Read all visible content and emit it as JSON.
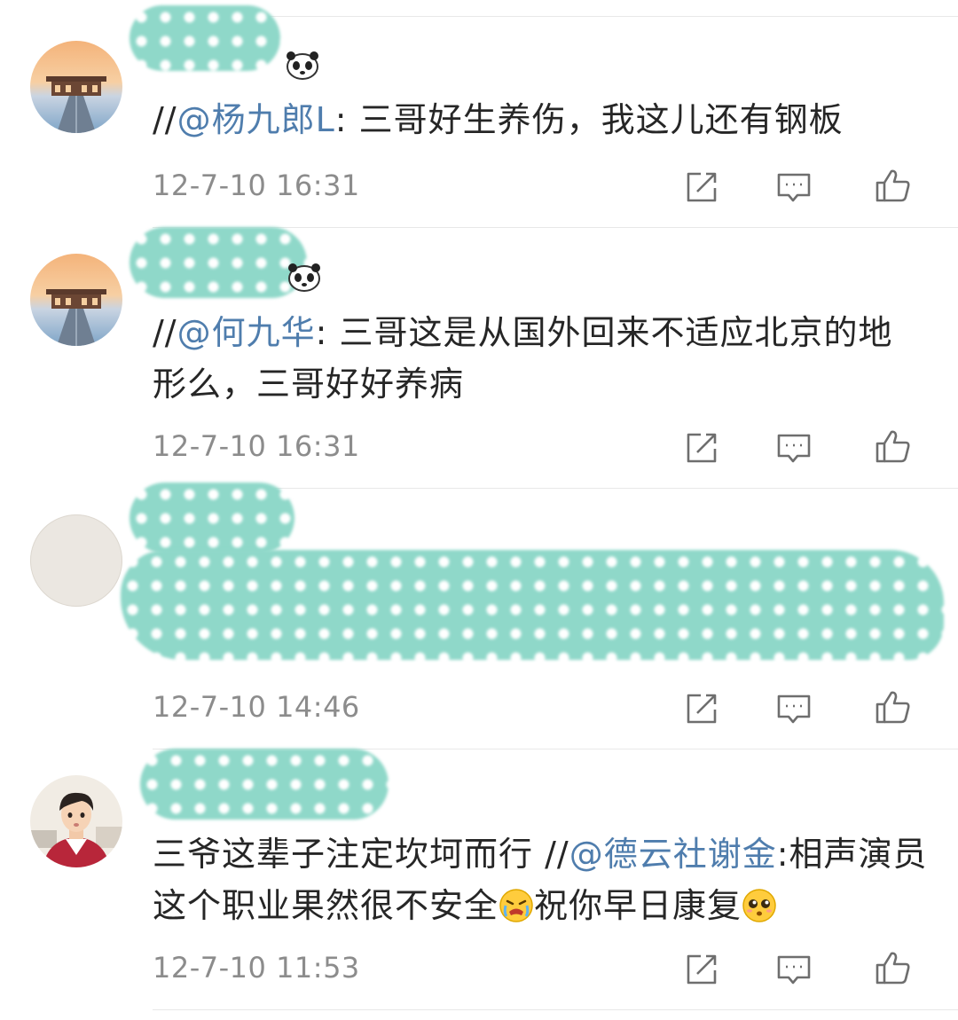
{
  "comments": [
    {
      "segments": [
        {
          "text": "//",
          "type": "plain"
        },
        {
          "text": "@杨九郎L",
          "type": "mention"
        },
        {
          "text": ": 三哥好生养伤，我这儿还有钢板",
          "type": "plain"
        }
      ],
      "time": "12-7-10 16:31"
    },
    {
      "segments": [
        {
          "text": "//",
          "type": "plain"
        },
        {
          "text": "@何九华",
          "type": "mention"
        },
        {
          "text": ": 三哥这是从国外回来不适应北京的地形么，三哥好好养病",
          "type": "plain"
        }
      ],
      "time": "12-7-10 16:31"
    },
    {
      "segments": [],
      "time": "12-7-10 14:46"
    },
    {
      "segments": [
        {
          "text": "三爷这辈子注定坎坷而行 //",
          "type": "plain"
        },
        {
          "text": "@德云社谢金",
          "type": "mention"
        },
        {
          "text": ":相声演员这个职业果然很不安全",
          "type": "plain"
        },
        {
          "text": "crying-emoji",
          "type": "emoji"
        },
        {
          "text": "祝你早日康复",
          "type": "plain"
        },
        {
          "text": "pleading-emoji",
          "type": "emoji"
        }
      ],
      "time": "12-7-10 11:53"
    }
  ],
  "icons": {
    "share": "share-icon",
    "comment": "comment-icon",
    "like": "thumbs-up-icon",
    "badge": "panda-icon"
  },
  "colors": {
    "mention": "#4f7dad",
    "redaction": "#8fd8c9",
    "time": "#8c8c8c"
  }
}
